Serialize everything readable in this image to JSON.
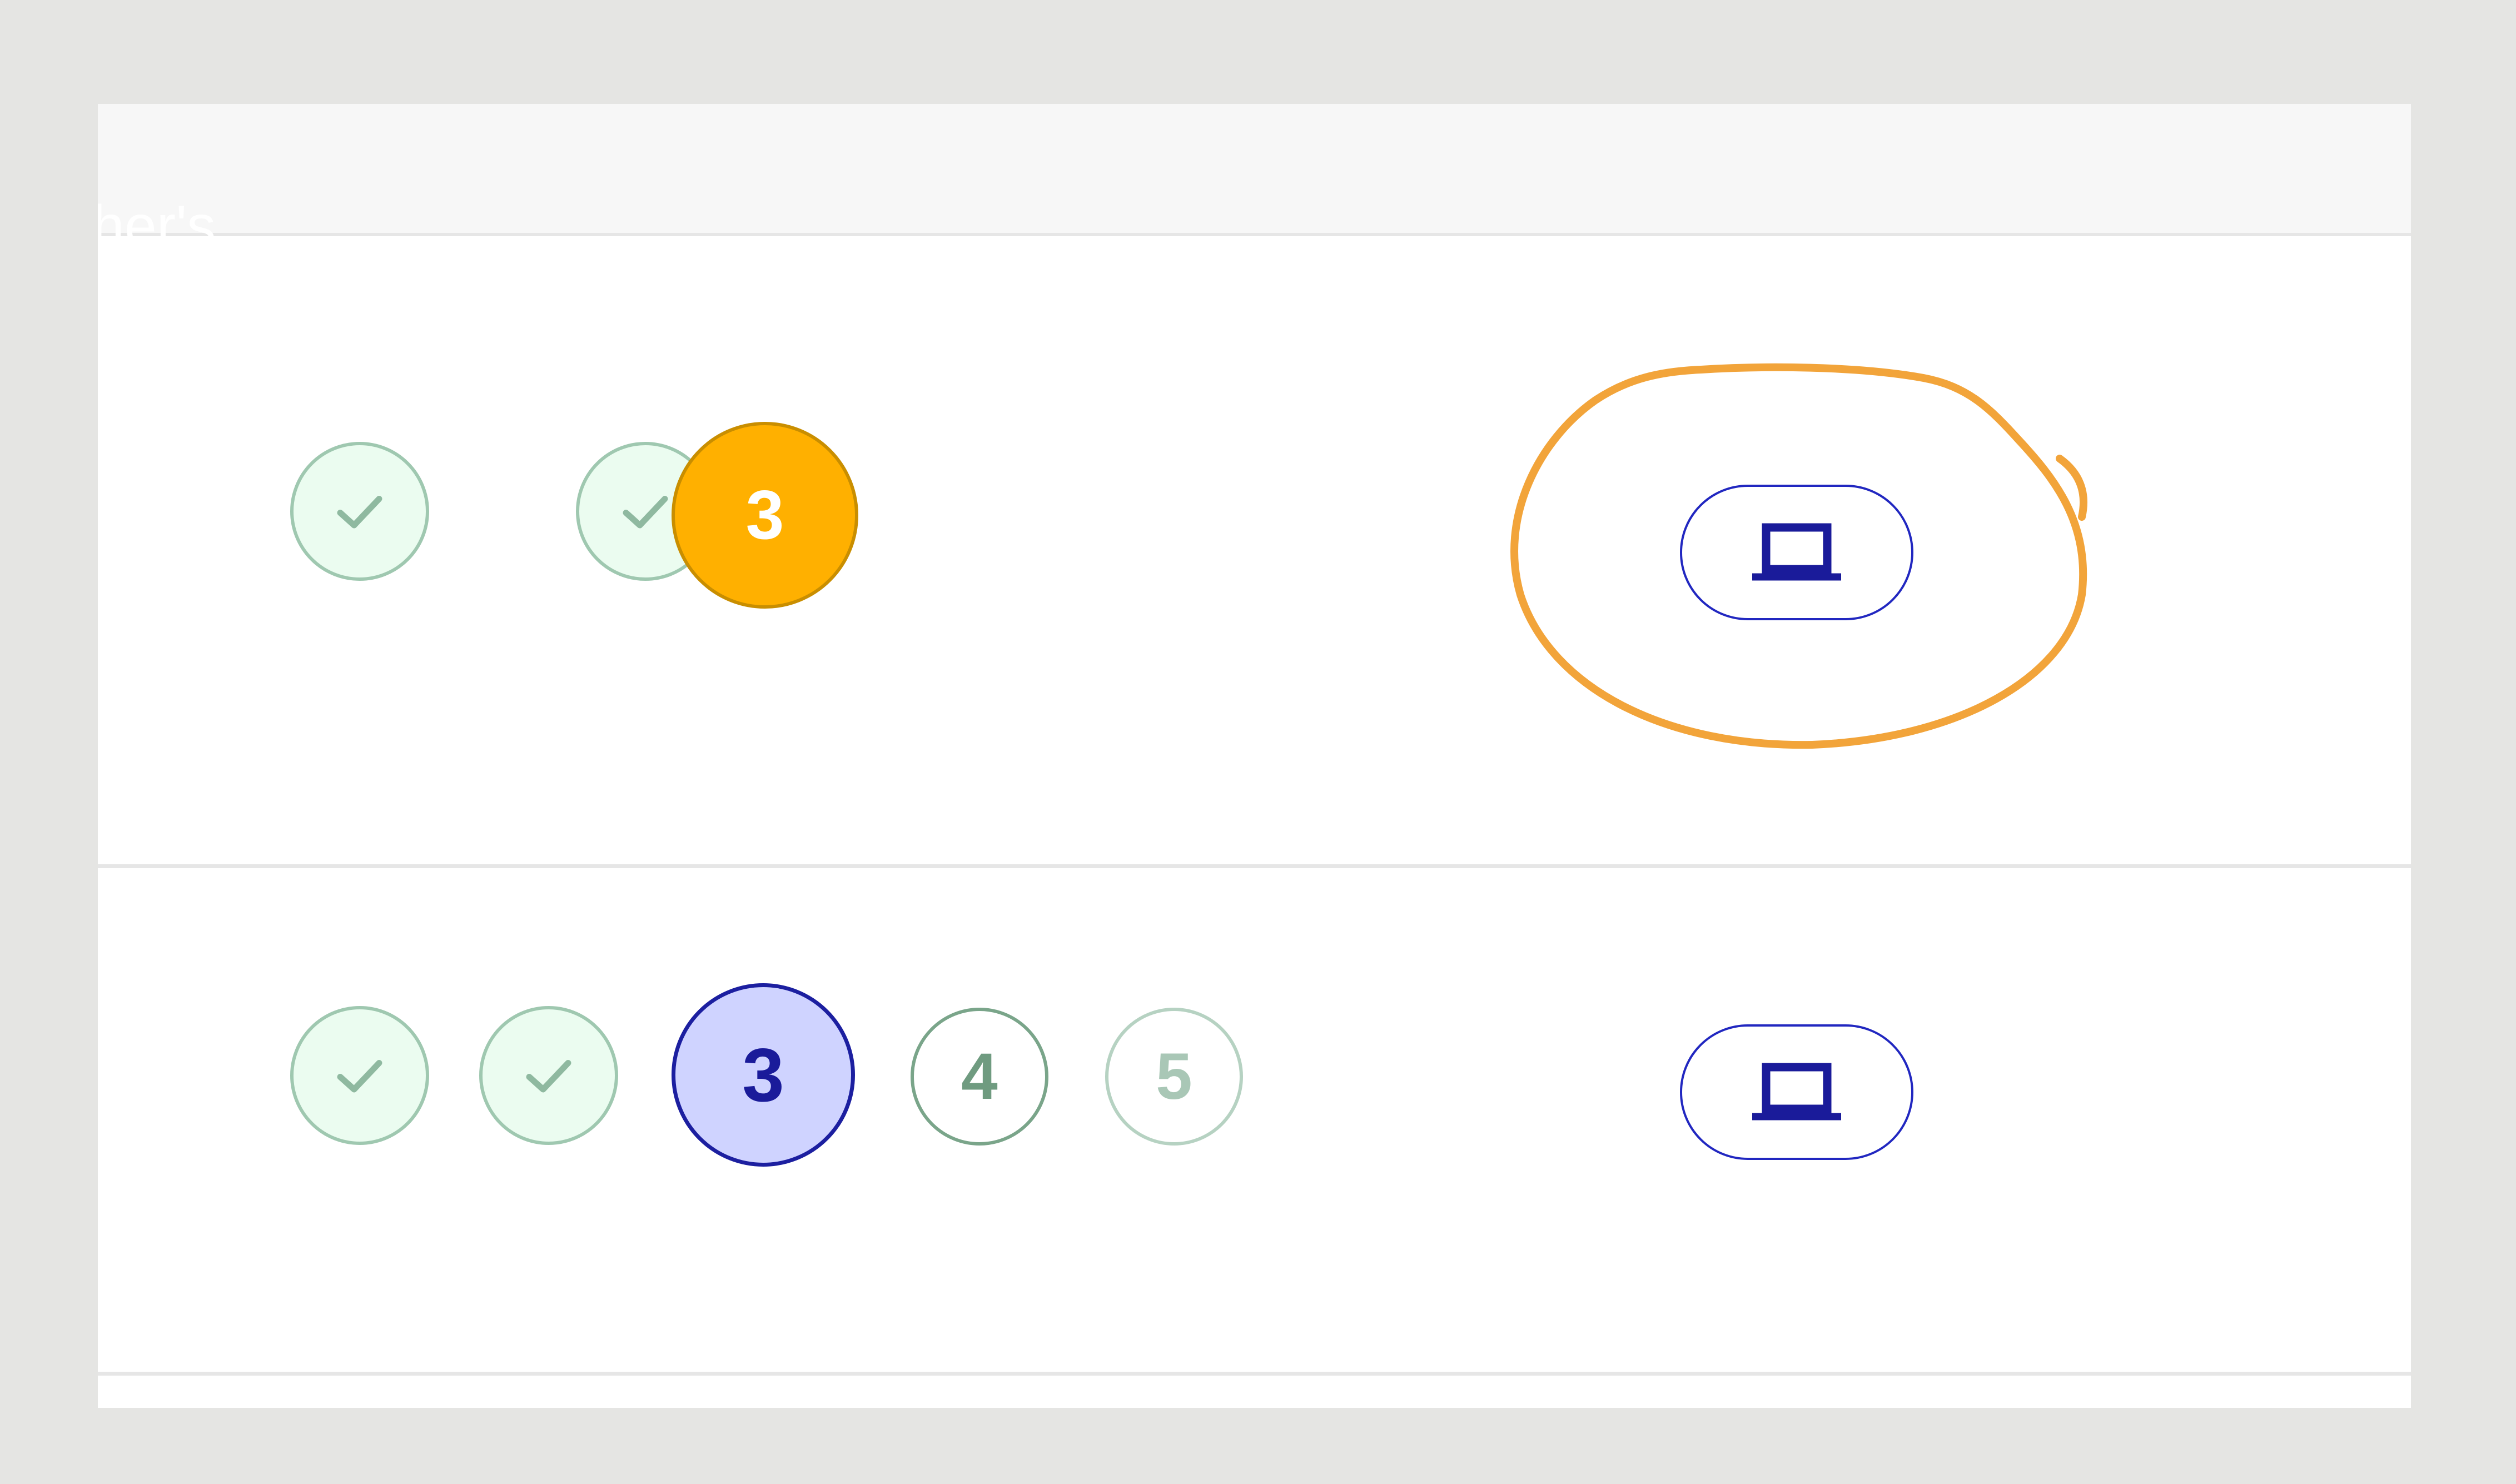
{
  "header": {
    "text": "her's"
  },
  "rows": [
    {
      "steps": [
        {
          "state": "done",
          "icon": "check-icon"
        },
        {
          "state": "done",
          "icon": "check-icon"
        },
        {
          "state": "current",
          "label": "3"
        }
      ],
      "action": {
        "icon": "laptop-icon",
        "highlighted": true
      }
    },
    {
      "steps": [
        {
          "state": "done",
          "icon": "check-icon"
        },
        {
          "state": "done",
          "icon": "check-icon"
        },
        {
          "state": "current",
          "label": "3"
        },
        {
          "state": "upcoming",
          "label": "4"
        },
        {
          "state": "upcoming",
          "label": "5"
        }
      ],
      "action": {
        "icon": "laptop-icon",
        "highlighted": false
      }
    }
  ],
  "colors": {
    "page_background": "#e5e5e3",
    "done_fill": "#ebfcf0",
    "done_border": "#9fc8b0",
    "current_orange": "#ffb000",
    "current_blue_fill": "#cfd3ff",
    "current_blue_text": "#1a1b9a",
    "button_border": "#2127c0",
    "annotation_stroke": "#f2a43a"
  }
}
